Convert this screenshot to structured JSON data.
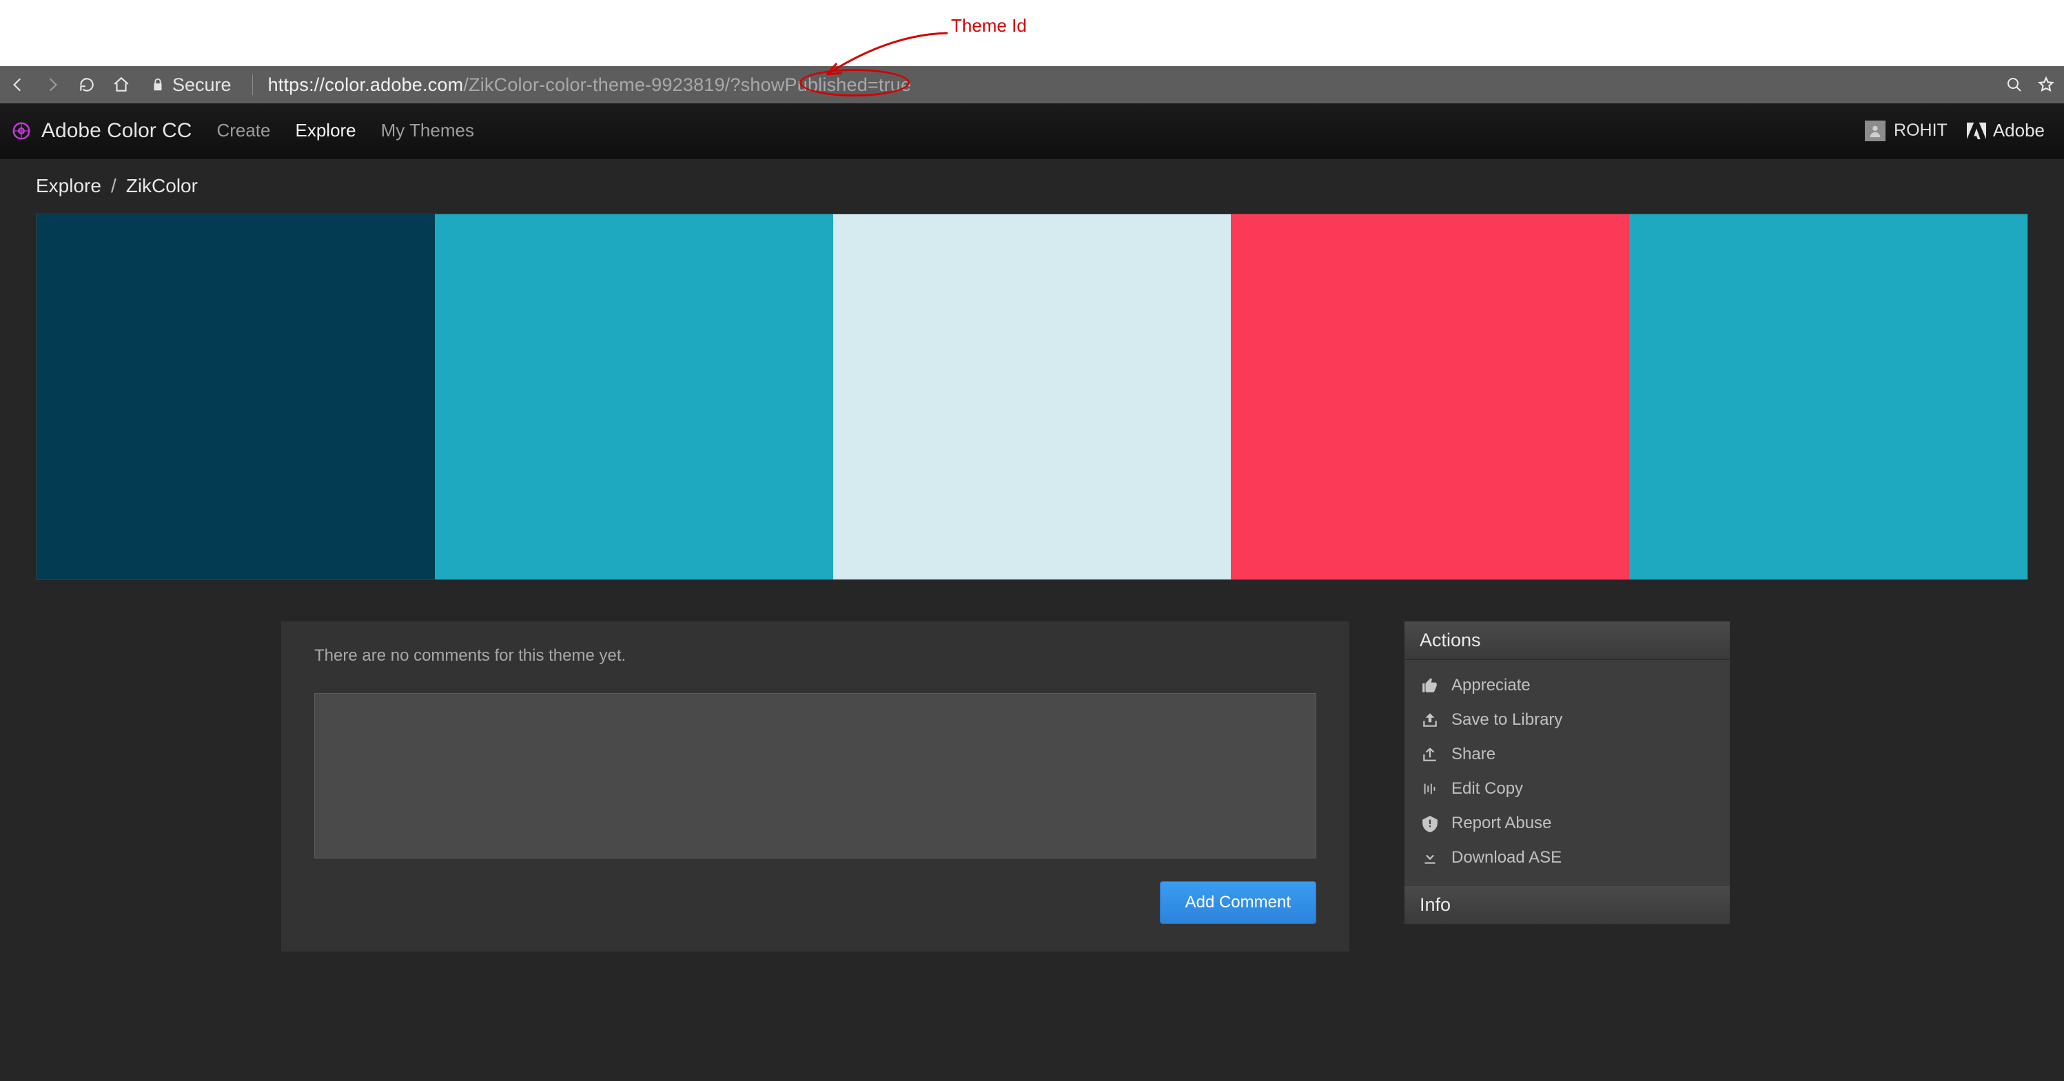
{
  "annotation": {
    "label": "Theme Id"
  },
  "browser": {
    "secure_label": "Secure",
    "url_host": "https://color.adobe.com",
    "url_path_pre": "/ZikColor-color-theme-",
    "url_theme_id": "9923819",
    "url_path_post": "/?showPublished=true"
  },
  "nav": {
    "app_title": "Adobe Color CC",
    "tabs": {
      "create": "Create",
      "explore": "Explore",
      "mythemes": "My Themes"
    },
    "user_name": "ROHIT",
    "adobe_label": "Adobe"
  },
  "breadcrumb": {
    "root": "Explore",
    "sep": "/",
    "current": "ZikColor"
  },
  "palette": {
    "colors": [
      "#023b52",
      "#1fa9c0",
      "#d5ebf0",
      "#fb3a57",
      "#1fa9c0"
    ]
  },
  "comments": {
    "empty_text": "There are no comments for this theme yet.",
    "placeholder": "",
    "button": "Add Comment"
  },
  "actions": {
    "heading": "Actions",
    "items": [
      {
        "icon": "thumbs-up-icon",
        "label": "Appreciate"
      },
      {
        "icon": "save-library-icon",
        "label": "Save to Library"
      },
      {
        "icon": "share-icon",
        "label": "Share"
      },
      {
        "icon": "edit-copy-icon",
        "label": "Edit Copy"
      },
      {
        "icon": "report-icon",
        "label": "Report Abuse"
      },
      {
        "icon": "download-icon",
        "label": "Download ASE"
      }
    ]
  },
  "info": {
    "heading": "Info"
  }
}
